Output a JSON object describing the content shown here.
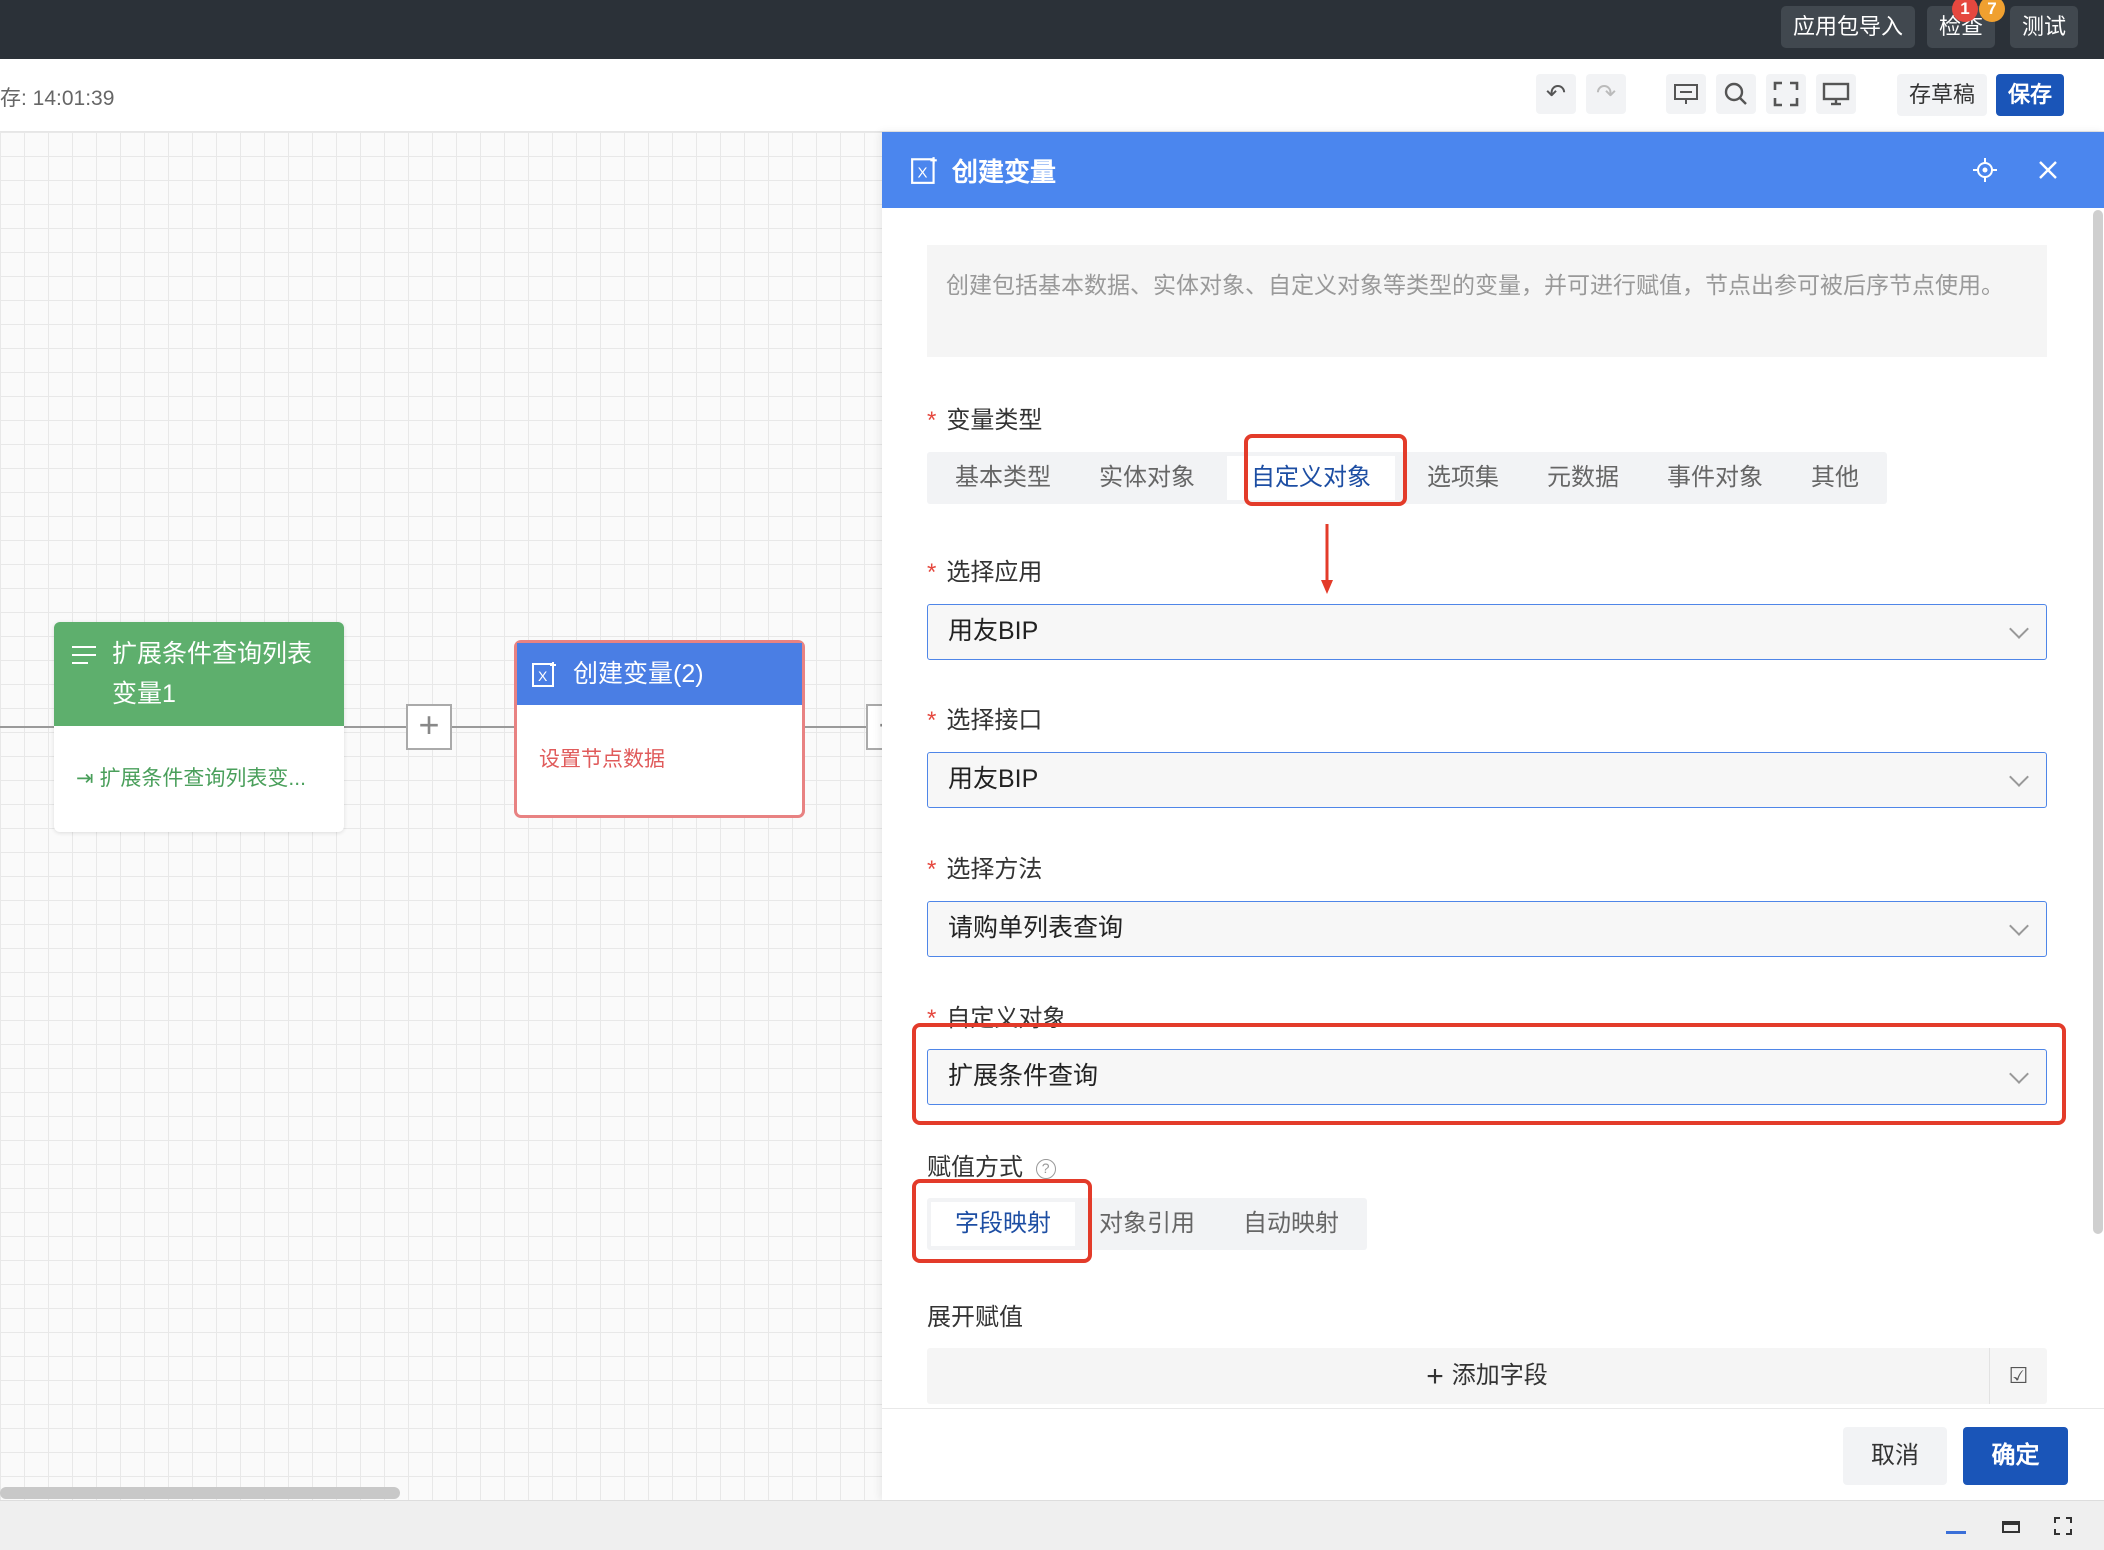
{
  "topbar": {
    "import_label": "应用包导入",
    "check_label": "检查",
    "check_badge_red": "1",
    "check_badge_orange": "7",
    "test_label": "测试"
  },
  "toolbar": {
    "save_time": "存: 14:01:39",
    "draft_label": "存草稿",
    "save_label": "保存"
  },
  "canvas": {
    "node1": {
      "title": "扩展条件查询列表变量1",
      "body": "扩展条件查询列表变..."
    },
    "node2": {
      "title": "创建变量(2)",
      "body": "设置节点数据"
    }
  },
  "panel": {
    "title": "创建变量",
    "description": "创建包括基本数据、实体对象、自定义对象等类型的变量，并可进行赋值，节点出参可被后序节点使用。",
    "variable_type": {
      "label": "变量类型",
      "options": [
        "基本类型",
        "实体对象",
        "自定义对象",
        "选项集",
        "元数据",
        "事件对象",
        "其他"
      ],
      "selected": "自定义对象"
    },
    "select_app": {
      "label": "选择应用",
      "value": "用友BIP"
    },
    "select_interface": {
      "label": "选择接口",
      "value": "用友BIP"
    },
    "select_method": {
      "label": "选择方法",
      "value": "请购单列表查询"
    },
    "custom_object": {
      "label": "自定义对象",
      "value": "扩展条件查询"
    },
    "assign_mode": {
      "label": "赋值方式",
      "options": [
        "字段映射",
        "对象引用",
        "自动映射"
      ],
      "selected": "字段映射"
    },
    "expand_assign": {
      "label": "展开赋值",
      "add_field": "添加字段"
    },
    "footer": {
      "cancel": "取消",
      "confirm": "确定"
    }
  },
  "colors": {
    "primary": "#4b86ee",
    "confirm": "#1a55b8",
    "node_green": "#5eaf6d",
    "highlight_red": "#e33b2a"
  }
}
